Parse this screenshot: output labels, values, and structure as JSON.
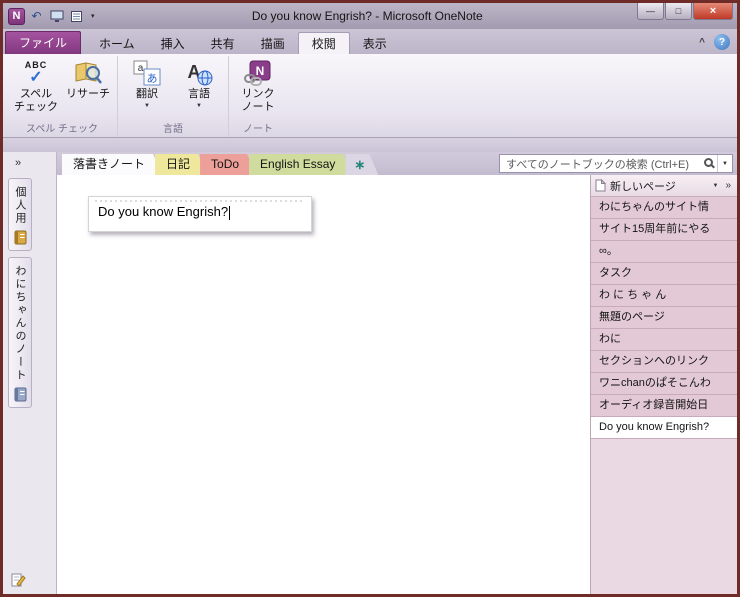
{
  "colors": {
    "window_frame": "#6f2b27",
    "file_tab": "#82387e",
    "close_button": "#bf3a28",
    "pages_panel_bg": "#ead8e2",
    "page_row_bg": "#e2c9d5",
    "selected_page_bg": "#ffffff"
  },
  "icons": {
    "logo_letter": "N",
    "undo": "↶",
    "qat_dropdown": "▾",
    "minimize": "—",
    "maximize": "□",
    "close": "×",
    "ribbon_collapse": "^",
    "help": "?",
    "spell_abc": "ABC",
    "spell_check": "✓",
    "translate_a": "a",
    "translate_hira": "あ",
    "language_a": "A",
    "linked_n": "N",
    "dropdown_small": "▼",
    "expand": "»",
    "new_section": "∗"
  },
  "titlebar": {
    "title": "Do you know Engrish? -  Microsoft OneNote"
  },
  "ribbon": {
    "file_tab": "ファイル",
    "tabs": [
      {
        "label": "ホーム"
      },
      {
        "label": "挿入"
      },
      {
        "label": "共有"
      },
      {
        "label": "描画"
      },
      {
        "label": "校閲"
      },
      {
        "label": "表示"
      }
    ],
    "active_tab": "校閲",
    "groups": [
      {
        "label": "スペル チェック",
        "buttons": [
          {
            "line1": "スペル",
            "line2": "チェック"
          },
          {
            "line1": "リサーチ"
          }
        ]
      },
      {
        "label": "言語",
        "buttons": [
          {
            "line1": "翻訳",
            "dropdown": "▼"
          },
          {
            "line1": "言語",
            "dropdown": "▼"
          }
        ]
      },
      {
        "label": "ノート",
        "buttons": [
          {
            "line1": "リンク",
            "line2": "ノート",
            "dropdown": "▼"
          }
        ]
      }
    ]
  },
  "navigation": {
    "sections": [
      {
        "label": "落書きノート",
        "color": "#fbfafc",
        "active": true
      },
      {
        "label": "日記",
        "color": "#efe89c"
      },
      {
        "label": "ToDo",
        "color": "#eda09a"
      },
      {
        "label": "English Essay",
        "color": "#cfdc9e"
      }
    ],
    "search": {
      "placeholder": "すべてのノートブックの検索 (Ctrl+E)"
    }
  },
  "sidebar": {
    "notebooks": [
      {
        "label": "個人用"
      },
      {
        "label": "わにちゃんのノート"
      }
    ]
  },
  "page": {
    "note_text": "Do you know Engrish?"
  },
  "pages_panel": {
    "new_page_label": "新しいページ",
    "pages": [
      {
        "title": "わにちゃんのサイト情"
      },
      {
        "title": "サイト15周年前にやる"
      },
      {
        "title": "∞。"
      },
      {
        "title": "タスク"
      },
      {
        "title": "わ に ち ゃ ん"
      },
      {
        "title": "無題のページ"
      },
      {
        "title": "わに"
      },
      {
        "title": "セクションへのリンク"
      },
      {
        "title": "ワニchanのぱそこんわ"
      },
      {
        "title": "オーディオ録音開始日"
      },
      {
        "title": "Do you know Engrish?",
        "selected": true
      }
    ]
  }
}
